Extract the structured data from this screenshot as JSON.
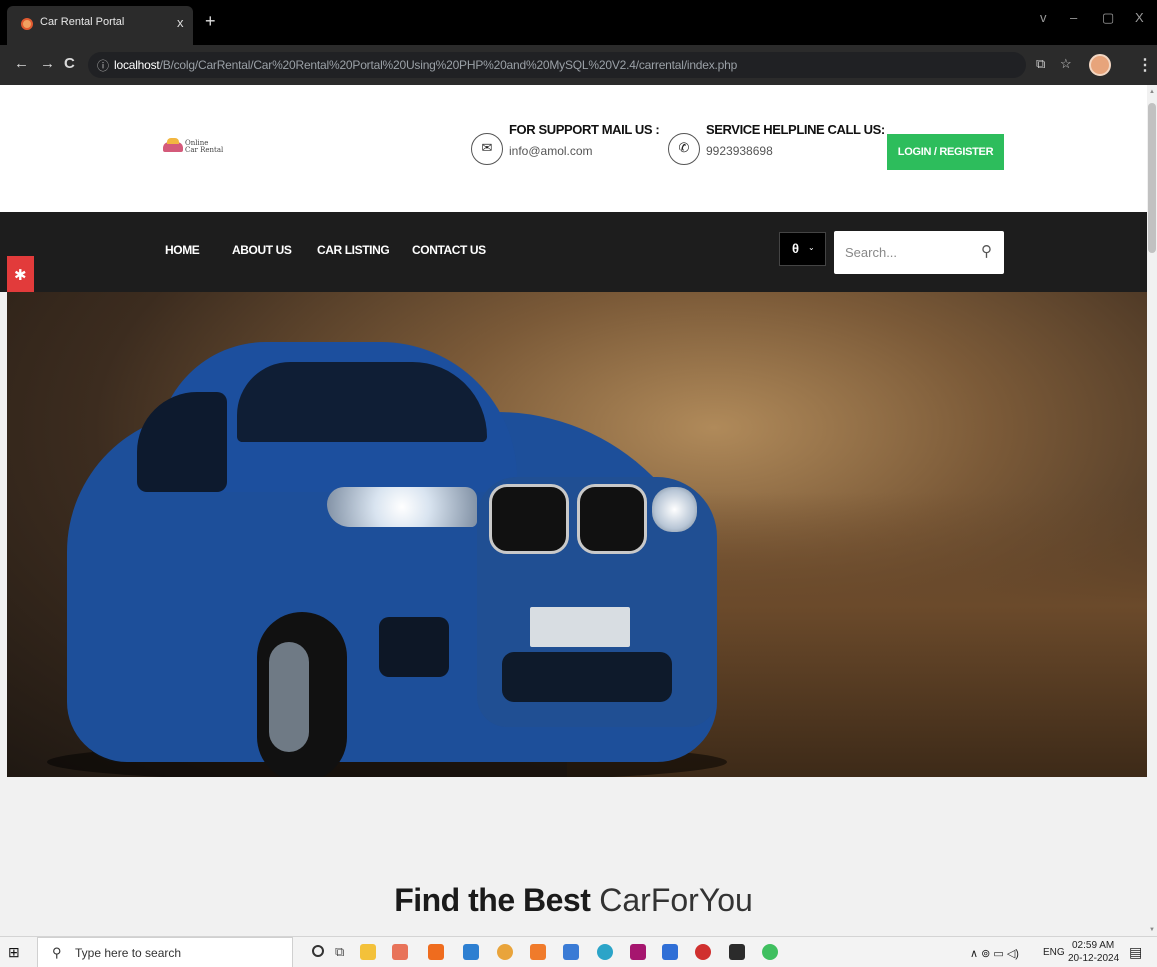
{
  "browser": {
    "tab_title": "Car Rental Portal",
    "tab_close": "x",
    "new_tab": "+",
    "window_controls": [
      "v",
      "–",
      "▢",
      "X"
    ],
    "url_host": "localhost",
    "url_path": "/B/colg/CarRental/Car%20Rental%20Portal%20Using%20PHP%20and%20MySQL%20V2.4/carrental/index.php",
    "back": "←",
    "forward": "→",
    "reload": "C",
    "info_glyph": "ⓘ",
    "menu_glyph": "⋮"
  },
  "header": {
    "logo_text_line1": "Online",
    "logo_text_line2": "Car Rental",
    "support_title": "FOR SUPPORT MAIL US :",
    "support_value": "info@amol.com",
    "helpline_title": "SERVICE HELPLINE CALL US:",
    "helpline_value": "9923938698",
    "login_label": "LOGIN / REGISTER"
  },
  "nav": {
    "items": [
      {
        "label": "HOME"
      },
      {
        "label": "ABOUT US"
      },
      {
        "label": "CAR LISTING"
      },
      {
        "label": "CONTACT US"
      }
    ],
    "search_placeholder": "Search..."
  },
  "main": {
    "section_title_bold": "Find the Best",
    "section_title_light": "CarForYou"
  },
  "taskbar": {
    "search_placeholder": "Type here to search",
    "tray_lang": "ENG",
    "tray_time": "02:59 AM",
    "tray_date": "20-12-2024"
  },
  "colors": {
    "accent_green": "#2dbd5c",
    "navbar_bg": "#1d1d1d",
    "gear_red": "#e23b3b"
  }
}
